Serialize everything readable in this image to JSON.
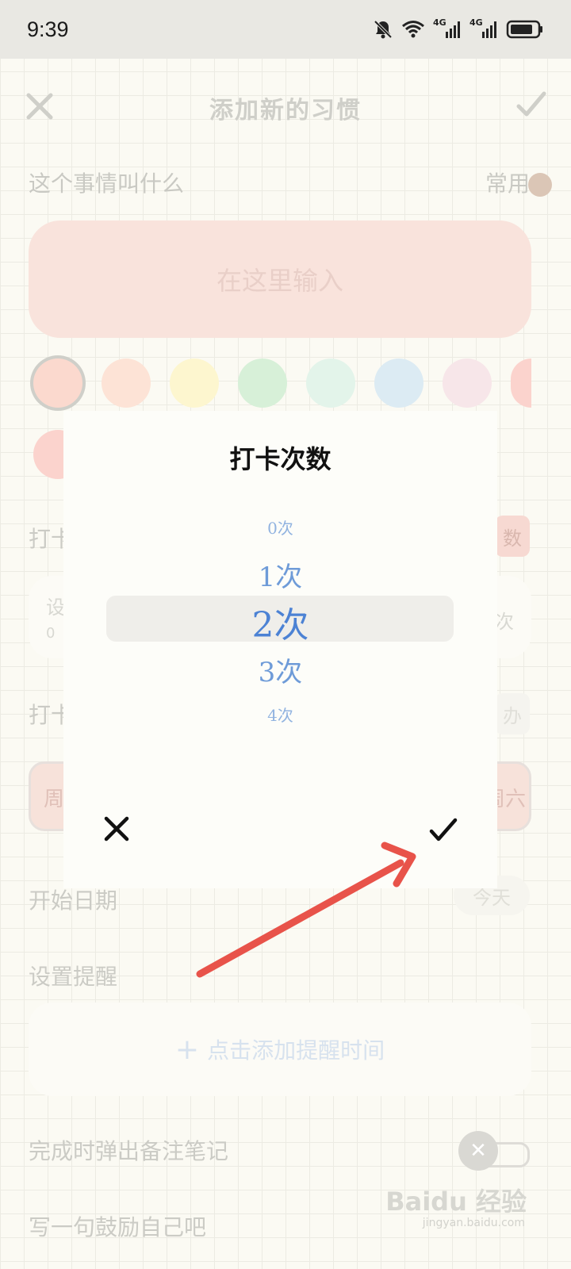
{
  "status_bar": {
    "time": "9:39",
    "icons": [
      "bell-muted-icon",
      "wifi-icon",
      "signal-4g-icon",
      "signal-4g-icon",
      "battery-icon"
    ],
    "net_label_1": "4G",
    "net_label_2": "4G"
  },
  "header": {
    "title": "添加新的习惯",
    "close_icon": "close-icon",
    "confirm_icon": "check-icon"
  },
  "form": {
    "name_label": "这个事情叫什么",
    "common_label": "常用",
    "name_placeholder": "在这里输入",
    "colors": [
      "#fbd9ce",
      "#fde3d6",
      "#fdf6cf",
      "#d7f0d8",
      "#e3f4ea",
      "#dcebf3",
      "#f7e6e9",
      "#fbd3cd"
    ],
    "section_count_label": "打卡",
    "count_chip": "数",
    "card_text_1": "设",
    "card_text_2": "0",
    "card_right": "次",
    "section_days_label": "打卡",
    "days_chip": "办",
    "week_left": "周",
    "week_right": "周六",
    "start_date_label": "开始日期",
    "start_date_value": "今天",
    "reminder_label": "设置提醒",
    "reminder_add": "点击添加提醒时间",
    "note_popup_label": "完成时弹出备注笔记",
    "motto_label": "写一句鼓励自己吧"
  },
  "modal": {
    "title": "打卡次数",
    "options": [
      "0次",
      "1次",
      "2次",
      "3次",
      "4次"
    ],
    "selected": "2次",
    "cancel_icon": "close-icon",
    "ok_icon": "check-icon"
  },
  "annotation": {
    "arrow_color": "#e8534a"
  },
  "watermark": {
    "text": "Baidu 经验",
    "sub": "jingyan.baidu.com"
  }
}
